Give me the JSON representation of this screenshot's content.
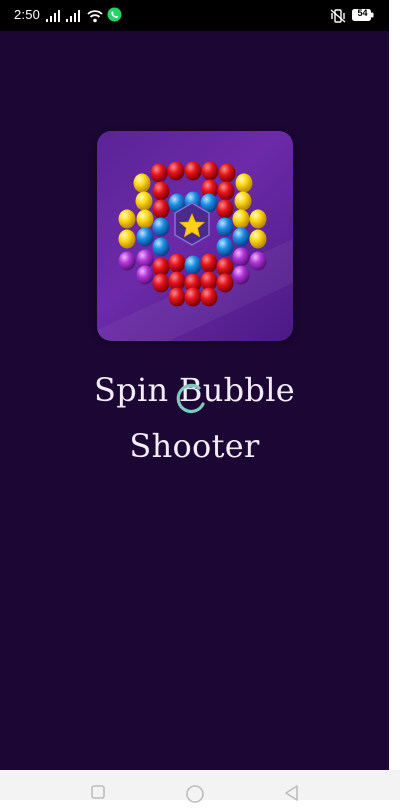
{
  "status_bar": {
    "time": "2:50",
    "battery_level": "54",
    "icons": [
      "signal-bars-icon",
      "signal-bars-icon",
      "wifi-icon",
      "whatsapp-notification-icon",
      "vibrate-mute-icon",
      "battery-icon"
    ]
  },
  "splash": {
    "app_title_line1": "Spin Bubble",
    "app_title_line2": "Shooter",
    "loading_indicator": "spinner-icon"
  },
  "nav_bar": {
    "buttons": [
      "recent-apps-icon",
      "home-icon",
      "back-icon"
    ]
  },
  "colors": {
    "background": "#1c0633",
    "icon_bg": "#5a2496",
    "title": "#f2ecf8",
    "spinner": "#7fc8c0"
  }
}
